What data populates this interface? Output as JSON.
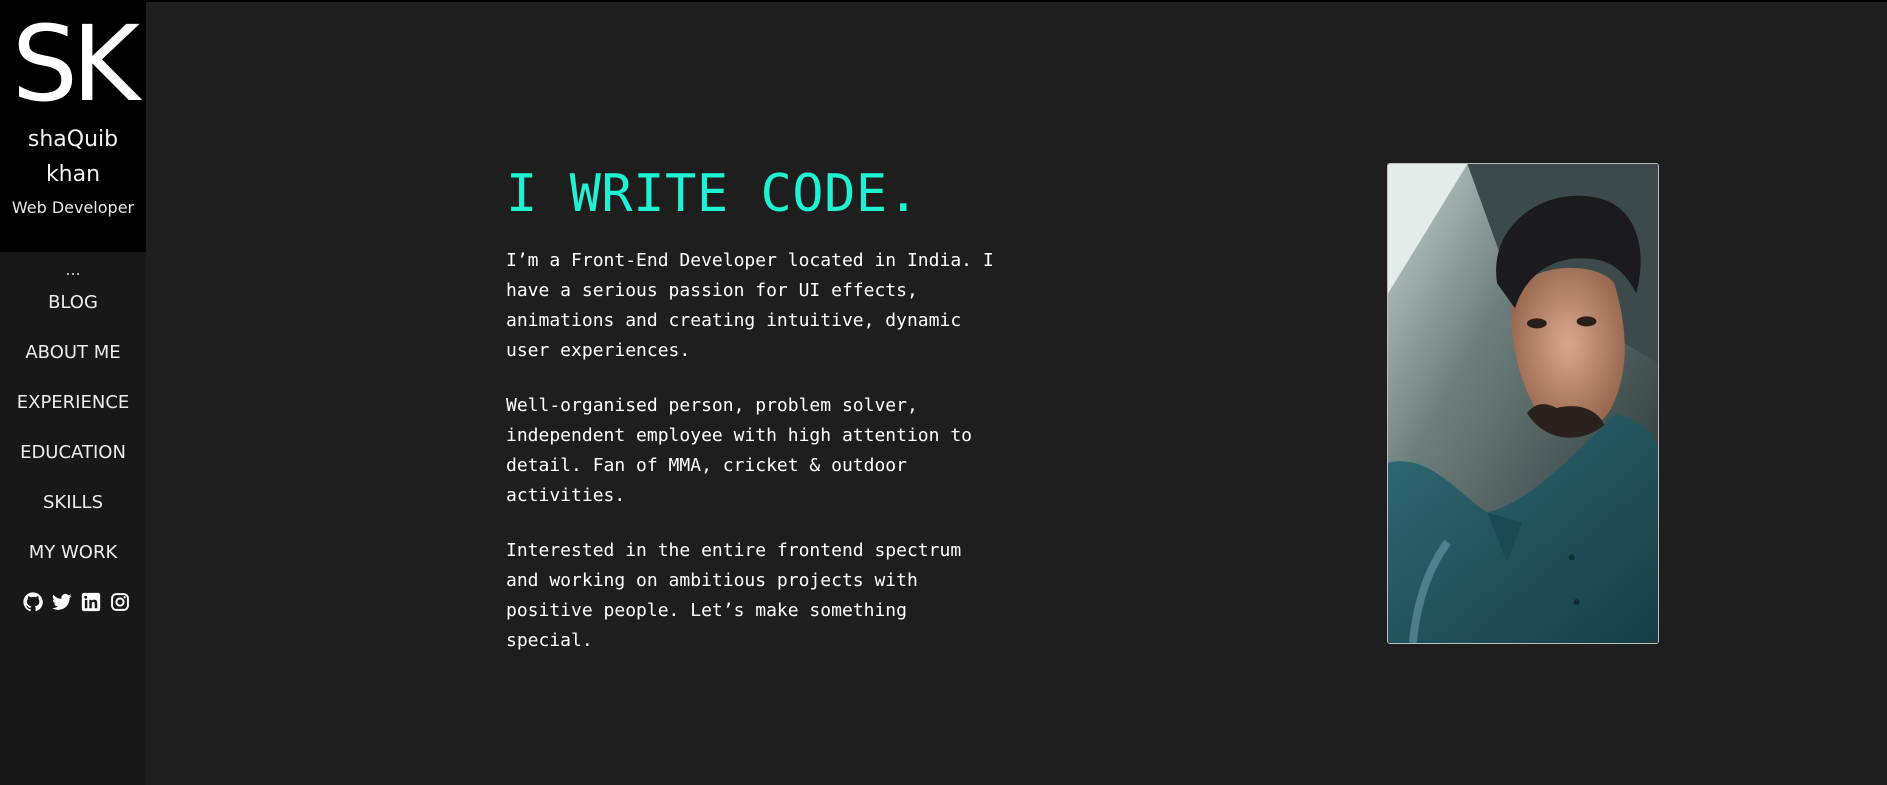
{
  "brand": {
    "logo": "SK",
    "name": "shaQuib khan",
    "role": "Web Developer"
  },
  "nav": {
    "dots": "...",
    "items": [
      {
        "label": "BLOG"
      },
      {
        "label": "ABOUT ME"
      },
      {
        "label": "EXPERIENCE"
      },
      {
        "label": "EDUCATION"
      },
      {
        "label": "SKILLS"
      },
      {
        "label": "MY WORK"
      }
    ],
    "social": [
      "github-icon",
      "twitter-icon",
      "linkedin-icon",
      "instagram-icon"
    ]
  },
  "hero": {
    "headline": "I WRITE CODE.",
    "paragraphs": [
      "I’m a Front-End Developer located in India. I have a serious passion for UI effects, animations and creating intuitive, dynamic user experiences.",
      "Well-organised person, problem solver, independent employee with high attention to detail. Fan of MMA, cricket & outdoor activities.",
      "Interested in the entire frontend spectrum and working on ambitious projects with positive people. Let’s make something special."
    ]
  },
  "colors": {
    "accent": "#1ff2d3",
    "background": "#1e1e1e",
    "sidebar": "#181818",
    "brand_bg": "#000000"
  }
}
